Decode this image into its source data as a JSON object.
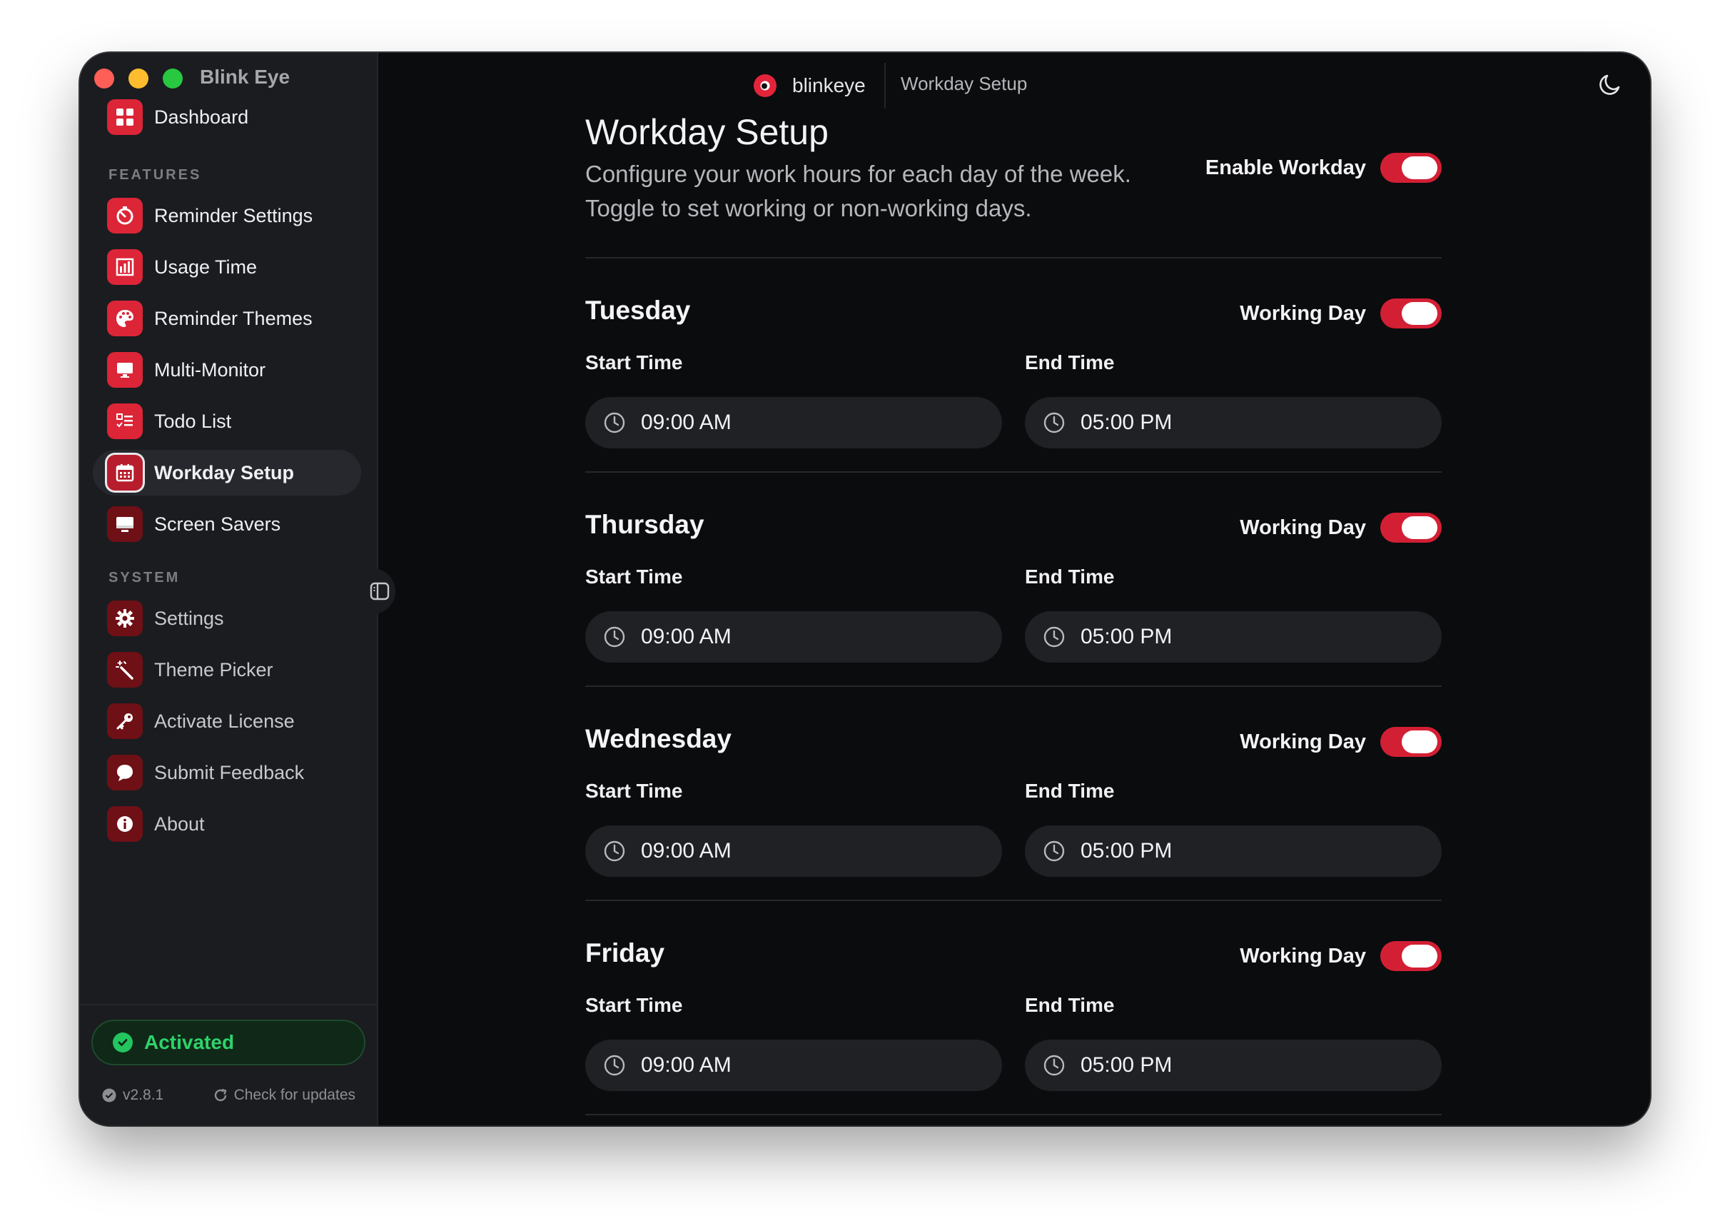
{
  "app": {
    "title": "Blink Eye",
    "brand_name": "blinkeye",
    "breadcrumb": "Workday Setup"
  },
  "sidebar": {
    "dashboard": "Dashboard",
    "features_heading": "FEATURES",
    "features": [
      {
        "label": "Reminder Settings",
        "icon": "stopwatch-icon"
      },
      {
        "label": "Usage Time",
        "icon": "bar-chart-icon"
      },
      {
        "label": "Reminder Themes",
        "icon": "palette-icon"
      },
      {
        "label": "Multi-Monitor",
        "icon": "monitor-icon"
      },
      {
        "label": "Todo List",
        "icon": "checklist-icon"
      },
      {
        "label": "Workday Setup",
        "icon": "calendar-icon"
      },
      {
        "label": "Screen Savers",
        "icon": "desktop-icon"
      }
    ],
    "system_heading": "SYSTEM",
    "system": [
      {
        "label": "Settings",
        "icon": "gear-icon"
      },
      {
        "label": "Theme Picker",
        "icon": "magic-wand-icon"
      },
      {
        "label": "Activate License",
        "icon": "key-icon"
      },
      {
        "label": "Submit Feedback",
        "icon": "chat-bubble-icon"
      },
      {
        "label": "About",
        "icon": "info-icon"
      }
    ],
    "active_item": "Workday Setup",
    "status": "Activated",
    "version": "v2.8.1",
    "update_label": "Check for updates"
  },
  "page": {
    "title": "Workday Setup",
    "subtitle_line1": "Configure your work hours for each day of the week.",
    "subtitle_line2": "Toggle to set working or non-working days.",
    "enable_label": "Enable Workday",
    "enable_on": true
  },
  "days": [
    {
      "name": "Tuesday",
      "toggle_label": "Working Day",
      "on": true,
      "start_label": "Start Time",
      "start": "09:00 AM",
      "end_label": "End Time",
      "end": "05:00 PM"
    },
    {
      "name": "Thursday",
      "toggle_label": "Working Day",
      "on": true,
      "start_label": "Start Time",
      "start": "09:00 AM",
      "end_label": "End Time",
      "end": "05:00 PM"
    },
    {
      "name": "Wednesday",
      "toggle_label": "Working Day",
      "on": true,
      "start_label": "Start Time",
      "start": "09:00 AM",
      "end_label": "End Time",
      "end": "05:00 PM"
    },
    {
      "name": "Friday",
      "toggle_label": "Working Day",
      "on": true,
      "start_label": "Start Time",
      "start": "09:00 AM",
      "end_label": "End Time",
      "end": "05:00 PM"
    }
  ],
  "colors": {
    "accent": "#dc2537",
    "success": "#22c55e",
    "background": "#0b0c0e",
    "sidebar": "#1a1c20"
  }
}
